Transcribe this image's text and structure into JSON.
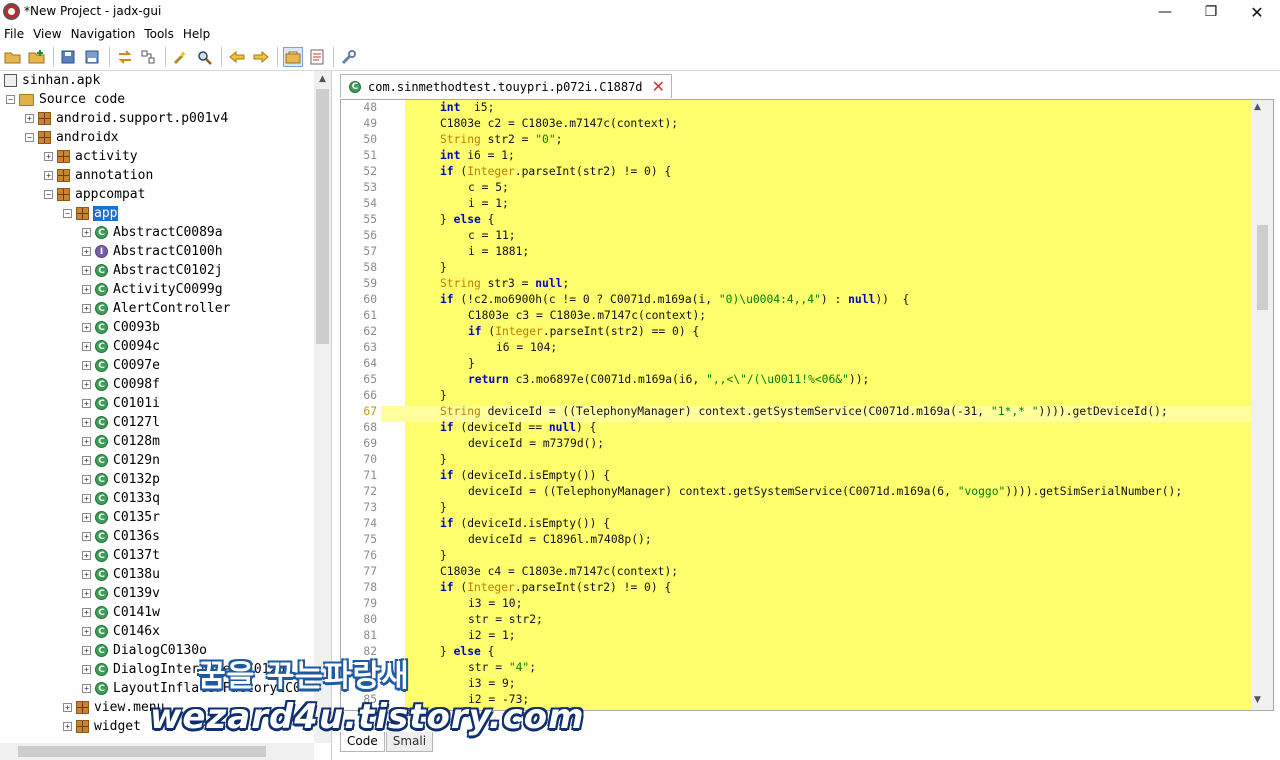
{
  "window": {
    "title": "*New Project - jadx-gui",
    "minimize_glyph": "—",
    "maximize_glyph": "❐",
    "close_glyph": "✕"
  },
  "menu": [
    "File",
    "View",
    "Navigation",
    "Tools",
    "Help"
  ],
  "toolbar": {
    "icons": [
      "open-file-icon",
      "add-files-icon",
      "save-all-icon",
      "export-gradle-icon",
      "sync-tree-icon",
      "flatten-packages-icon",
      "find-text-icon",
      "search-class-icon",
      "back-icon",
      "forward-icon",
      "deobfuscation-icon",
      "log-viewer-icon",
      "preferences-icon"
    ]
  },
  "tree": {
    "root": "sinhan.apk",
    "source_code": "Source code",
    "packages": {
      "support": "android.support.p001v4",
      "androidx": "androidx",
      "activity": "activity",
      "annotation": "annotation",
      "appcompat": "appcompat",
      "app": "app",
      "view_menu": "view.menu",
      "widget": "widget"
    },
    "classes": [
      {
        "name": "AbstractC0089a",
        "kind": "class"
      },
      {
        "name": "AbstractC0100h",
        "kind": "interface"
      },
      {
        "name": "AbstractC0102j",
        "kind": "class"
      },
      {
        "name": "ActivityC0099g",
        "kind": "class"
      },
      {
        "name": "AlertController",
        "kind": "class"
      },
      {
        "name": "C0093b",
        "kind": "class"
      },
      {
        "name": "C0094c",
        "kind": "class"
      },
      {
        "name": "C0097e",
        "kind": "class"
      },
      {
        "name": "C0098f",
        "kind": "class"
      },
      {
        "name": "C0101i",
        "kind": "class"
      },
      {
        "name": "C0127l",
        "kind": "class"
      },
      {
        "name": "C0128m",
        "kind": "class"
      },
      {
        "name": "C0129n",
        "kind": "class"
      },
      {
        "name": "C0132p",
        "kind": "class"
      },
      {
        "name": "C0133q",
        "kind": "class"
      },
      {
        "name": "C0135r",
        "kind": "class"
      },
      {
        "name": "C0136s",
        "kind": "class"
      },
      {
        "name": "C0137t",
        "kind": "class"
      },
      {
        "name": "C0138u",
        "kind": "class"
      },
      {
        "name": "C0139v",
        "kind": "class"
      },
      {
        "name": "C0141w",
        "kind": "class"
      },
      {
        "name": "C0146x",
        "kind": "class"
      },
      {
        "name": "DialogC0130o",
        "kind": "class"
      },
      {
        "name": "DialogInterfaceOnC0125c",
        "kind": "class"
      },
      {
        "name": "LayoutInflaterFactory2C0",
        "kind": "class"
      }
    ]
  },
  "editor": {
    "tab_label": "com.sinmethodtest.touypri.p072i.C1887d",
    "current_line": 67,
    "bottom_tabs": [
      "Code",
      "Smali"
    ],
    "lines": [
      {
        "n": 48,
        "indent": 0,
        "parts": [
          [
            "kw",
            "int"
          ],
          [
            "",
            "  i5;"
          ]
        ]
      },
      {
        "n": 49,
        "indent": 0,
        "parts": [
          [
            "",
            "C1803e c2 = C1803e.m7147c(context);"
          ]
        ]
      },
      {
        "n": 50,
        "indent": 0,
        "parts": [
          [
            "ty",
            "String"
          ],
          [
            "",
            " str2 = "
          ],
          [
            "st",
            "\"0\""
          ],
          [
            "",
            ";"
          ]
        ]
      },
      {
        "n": 51,
        "indent": 0,
        "parts": [
          [
            "kw",
            "int"
          ],
          [
            "",
            " i6 = 1;"
          ]
        ]
      },
      {
        "n": 52,
        "indent": 0,
        "parts": [
          [
            "kw",
            "if"
          ],
          [
            "",
            " ("
          ],
          [
            "ty",
            "Integer"
          ],
          [
            "",
            ".parseInt(str2) != 0) {"
          ]
        ]
      },
      {
        "n": 53,
        "indent": 1,
        "parts": [
          [
            "",
            "c = 5;"
          ]
        ]
      },
      {
        "n": 54,
        "indent": 1,
        "parts": [
          [
            "",
            "i = 1;"
          ]
        ]
      },
      {
        "n": 55,
        "indent": 0,
        "parts": [
          [
            "",
            "} "
          ],
          [
            "kw",
            "else"
          ],
          [
            "",
            " {"
          ]
        ]
      },
      {
        "n": 56,
        "indent": 1,
        "parts": [
          [
            "",
            "c = 11;"
          ]
        ]
      },
      {
        "n": 57,
        "indent": 1,
        "parts": [
          [
            "",
            "i = 1881;"
          ]
        ]
      },
      {
        "n": 58,
        "indent": 0,
        "parts": [
          [
            "",
            "}"
          ]
        ]
      },
      {
        "n": 59,
        "indent": 0,
        "parts": [
          [
            "ty",
            "String"
          ],
          [
            "",
            " str3 = "
          ],
          [
            "kw",
            "null"
          ],
          [
            "",
            ";"
          ]
        ]
      },
      {
        "n": 60,
        "indent": 0,
        "parts": [
          [
            "kw",
            "if"
          ],
          [
            "",
            " (!c2.mo6900h(c != 0 ? C0071d.m169a(i, "
          ],
          [
            "st",
            "\"0)\\u0004:4,,4\""
          ],
          [
            "",
            ") : "
          ],
          [
            "kw",
            "null"
          ],
          [
            "",
            "))  {"
          ]
        ]
      },
      {
        "n": 61,
        "indent": 1,
        "parts": [
          [
            "",
            "C1803e c3 = C1803e.m7147c(context);"
          ]
        ]
      },
      {
        "n": 62,
        "indent": 1,
        "parts": [
          [
            "kw",
            "if"
          ],
          [
            "",
            " ("
          ],
          [
            "ty",
            "Integer"
          ],
          [
            "",
            ".parseInt(str2) == 0) {"
          ]
        ]
      },
      {
        "n": 63,
        "indent": 2,
        "parts": [
          [
            "",
            "i6 = 104;"
          ]
        ]
      },
      {
        "n": 64,
        "indent": 1,
        "parts": [
          [
            "",
            "}"
          ]
        ]
      },
      {
        "n": 65,
        "indent": 1,
        "parts": [
          [
            "kw",
            "return"
          ],
          [
            "",
            " c3.mo6897e(C0071d.m169a(i6, "
          ],
          [
            "st",
            "\",,<\\\"/(\\u0011!%<06&\""
          ],
          [
            "",
            "));"
          ]
        ]
      },
      {
        "n": 66,
        "indent": 0,
        "parts": [
          [
            "",
            "}"
          ]
        ]
      },
      {
        "n": 67,
        "indent": 0,
        "parts": [
          [
            "ty",
            "String"
          ],
          [
            "",
            " deviceId = ((TelephonyManager) context.getSystemService(C0071d.m169a(-31, "
          ],
          [
            "st",
            "\"1*,* \""
          ],
          [
            "",
            ")))).getDeviceId();"
          ]
        ]
      },
      {
        "n": 68,
        "indent": 0,
        "parts": [
          [
            "kw",
            "if"
          ],
          [
            "",
            " (deviceId == "
          ],
          [
            "kw",
            "null"
          ],
          [
            "",
            ") {"
          ]
        ]
      },
      {
        "n": 69,
        "indent": 1,
        "parts": [
          [
            "",
            "deviceId = m7379d();"
          ]
        ]
      },
      {
        "n": 70,
        "indent": 0,
        "parts": [
          [
            "",
            "}"
          ]
        ]
      },
      {
        "n": 71,
        "indent": 0,
        "parts": [
          [
            "kw",
            "if"
          ],
          [
            "",
            " (deviceId.isEmpty()) {"
          ]
        ]
      },
      {
        "n": 72,
        "indent": 1,
        "parts": [
          [
            "",
            "deviceId = ((TelephonyManager) context.getSystemService(C0071d.m169a(6, "
          ],
          [
            "st",
            "\"voggo\""
          ],
          [
            "",
            ")))).getSimSerialNumber();"
          ]
        ]
      },
      {
        "n": 73,
        "indent": 0,
        "parts": [
          [
            "",
            "}"
          ]
        ]
      },
      {
        "n": 74,
        "indent": 0,
        "parts": [
          [
            "kw",
            "if"
          ],
          [
            "",
            " (deviceId.isEmpty()) {"
          ]
        ]
      },
      {
        "n": 75,
        "indent": 1,
        "parts": [
          [
            "",
            "deviceId = C1896l.m7408p();"
          ]
        ]
      },
      {
        "n": 76,
        "indent": 0,
        "parts": [
          [
            "",
            "}"
          ]
        ]
      },
      {
        "n": 77,
        "indent": 0,
        "parts": [
          [
            "",
            "C1803e c4 = C1803e.m7147c(context);"
          ]
        ]
      },
      {
        "n": 78,
        "indent": 0,
        "parts": [
          [
            "kw",
            "if"
          ],
          [
            "",
            " ("
          ],
          [
            "ty",
            "Integer"
          ],
          [
            "",
            ".parseInt(str2) != 0) {"
          ]
        ]
      },
      {
        "n": 79,
        "indent": 1,
        "parts": [
          [
            "",
            "i3 = 10;"
          ]
        ]
      },
      {
        "n": 80,
        "indent": 1,
        "parts": [
          [
            "",
            "str = str2;"
          ]
        ]
      },
      {
        "n": 81,
        "indent": 1,
        "parts": [
          [
            "",
            "i2 = 1;"
          ]
        ]
      },
      {
        "n": 82,
        "indent": 0,
        "parts": [
          [
            "",
            "} "
          ],
          [
            "kw",
            "else"
          ],
          [
            "",
            " {"
          ]
        ]
      },
      {
        "n": 83,
        "indent": 1,
        "parts": [
          [
            "",
            "str = "
          ],
          [
            "st",
            "\"4\""
          ],
          [
            "",
            ";"
          ]
        ]
      },
      {
        "n": 84,
        "indent": 1,
        "parts": [
          [
            "",
            "i3 = 9;"
          ]
        ]
      },
      {
        "n": 85,
        "indent": 1,
        "parts": [
          [
            "",
            "i2 = -73;"
          ]
        ]
      }
    ]
  },
  "watermark": {
    "line1": "꿈을 꾸는파랑새",
    "line2": "wezard4u.tistory.com"
  }
}
